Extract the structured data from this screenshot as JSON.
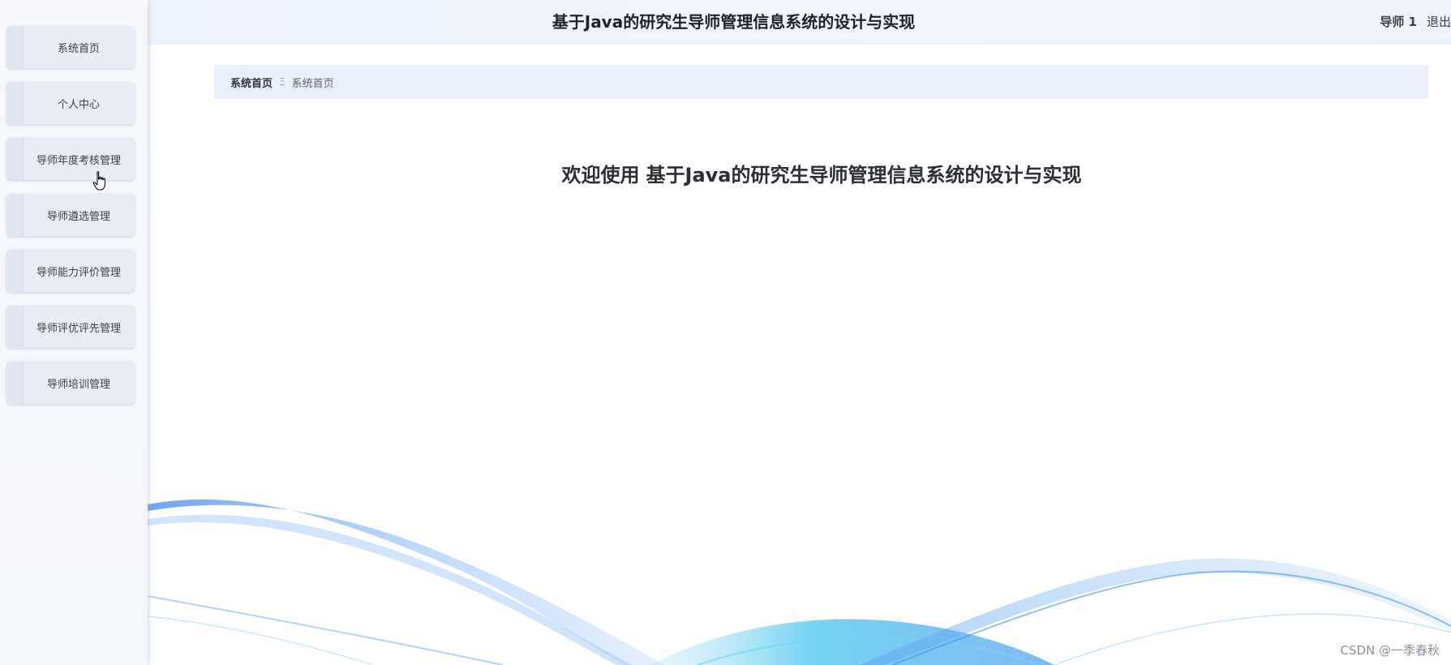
{
  "header": {
    "title": "基于Java的研究生导师管理信息系统的设计与实现",
    "user": "导师 1",
    "logout": "退出"
  },
  "sidebar": {
    "items": [
      {
        "label": "系统首页"
      },
      {
        "label": "个人中心"
      },
      {
        "label": "导师年度考核管理"
      },
      {
        "label": "导师遴选管理"
      },
      {
        "label": "导师能力评价管理"
      },
      {
        "label": "导师评优评先管理"
      },
      {
        "label": "导师培训管理"
      }
    ]
  },
  "breadcrumb": {
    "home": "系统首页",
    "separator": "Ξ",
    "current": "系统首页"
  },
  "main": {
    "welcome_prefix": "欢迎使用",
    "welcome_title": "基于Java的研究生导师管理信息系统的设计与实现"
  },
  "watermark": "CSDN @一季春秋",
  "icons": {
    "cursor": "hand-pointer-icon",
    "breadcrumb_separator": "menu-lines-icon"
  },
  "colors": {
    "sidebar_bg": "#f4f7fc",
    "menu_item_bg": "#e8ecf4",
    "header_bg": "#eef3fc",
    "breadcrumb_bg": "#e9f0fb",
    "wave_blue": "#5b9ef0",
    "wave_cyan": "#49c9f0"
  }
}
